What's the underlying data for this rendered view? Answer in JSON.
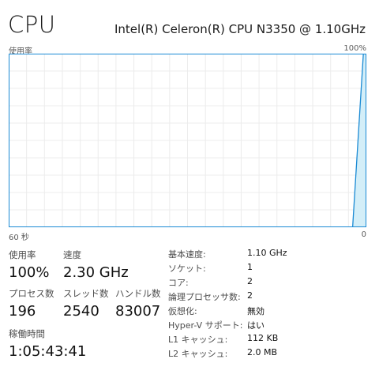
{
  "header": {
    "title": "CPU",
    "processor_name": "Intel(R) Celeron(R) CPU N3350 @ 1.10GHz"
  },
  "graph": {
    "y_label": "使用率",
    "y_max_label": "100%",
    "x_left_label": "60 秒",
    "x_right_label": "0",
    "line_color": "#1a8ad4",
    "fill_color": "#d3eef8",
    "grid_color": "#ececec",
    "border_color": "#1a8ad4"
  },
  "chart_data": {
    "type": "area",
    "xlabel": "",
    "ylabel": "使用率",
    "xlim": [
      60,
      0
    ],
    "ylim": [
      0,
      100
    ],
    "grid": true,
    "x": [
      60,
      2.3,
      0.5,
      0
    ],
    "values": [
      0,
      0,
      100,
      100
    ],
    "tick_labels": {
      "x_left": "60 秒",
      "x_right": "0",
      "y_top": "100%"
    }
  },
  "stats": {
    "usage": {
      "label": "使用率",
      "value": "100%"
    },
    "speed": {
      "label": "速度",
      "value": "2.30 GHz"
    },
    "processes": {
      "label": "プロセス数",
      "value": "196"
    },
    "threads": {
      "label": "スレッド数",
      "value": "2540"
    },
    "handles": {
      "label": "ハンドル数",
      "value": "83007"
    },
    "uptime": {
      "label": "稼働時間",
      "value": "1:05:43:41"
    }
  },
  "properties": [
    {
      "label": "基本速度:",
      "value": "1.10 GHz"
    },
    {
      "label": "ソケット:",
      "value": "1"
    },
    {
      "label": "コア:",
      "value": "2"
    },
    {
      "label": "論理プロセッサ数:",
      "value": "2"
    },
    {
      "label": "仮想化:",
      "value": "無効"
    },
    {
      "label": "Hyper-V サポート:",
      "value": "はい"
    },
    {
      "label": "L1 キャッシュ:",
      "value": "112 KB"
    },
    {
      "label": "L2 キャッシュ:",
      "value": "2.0 MB"
    }
  ]
}
